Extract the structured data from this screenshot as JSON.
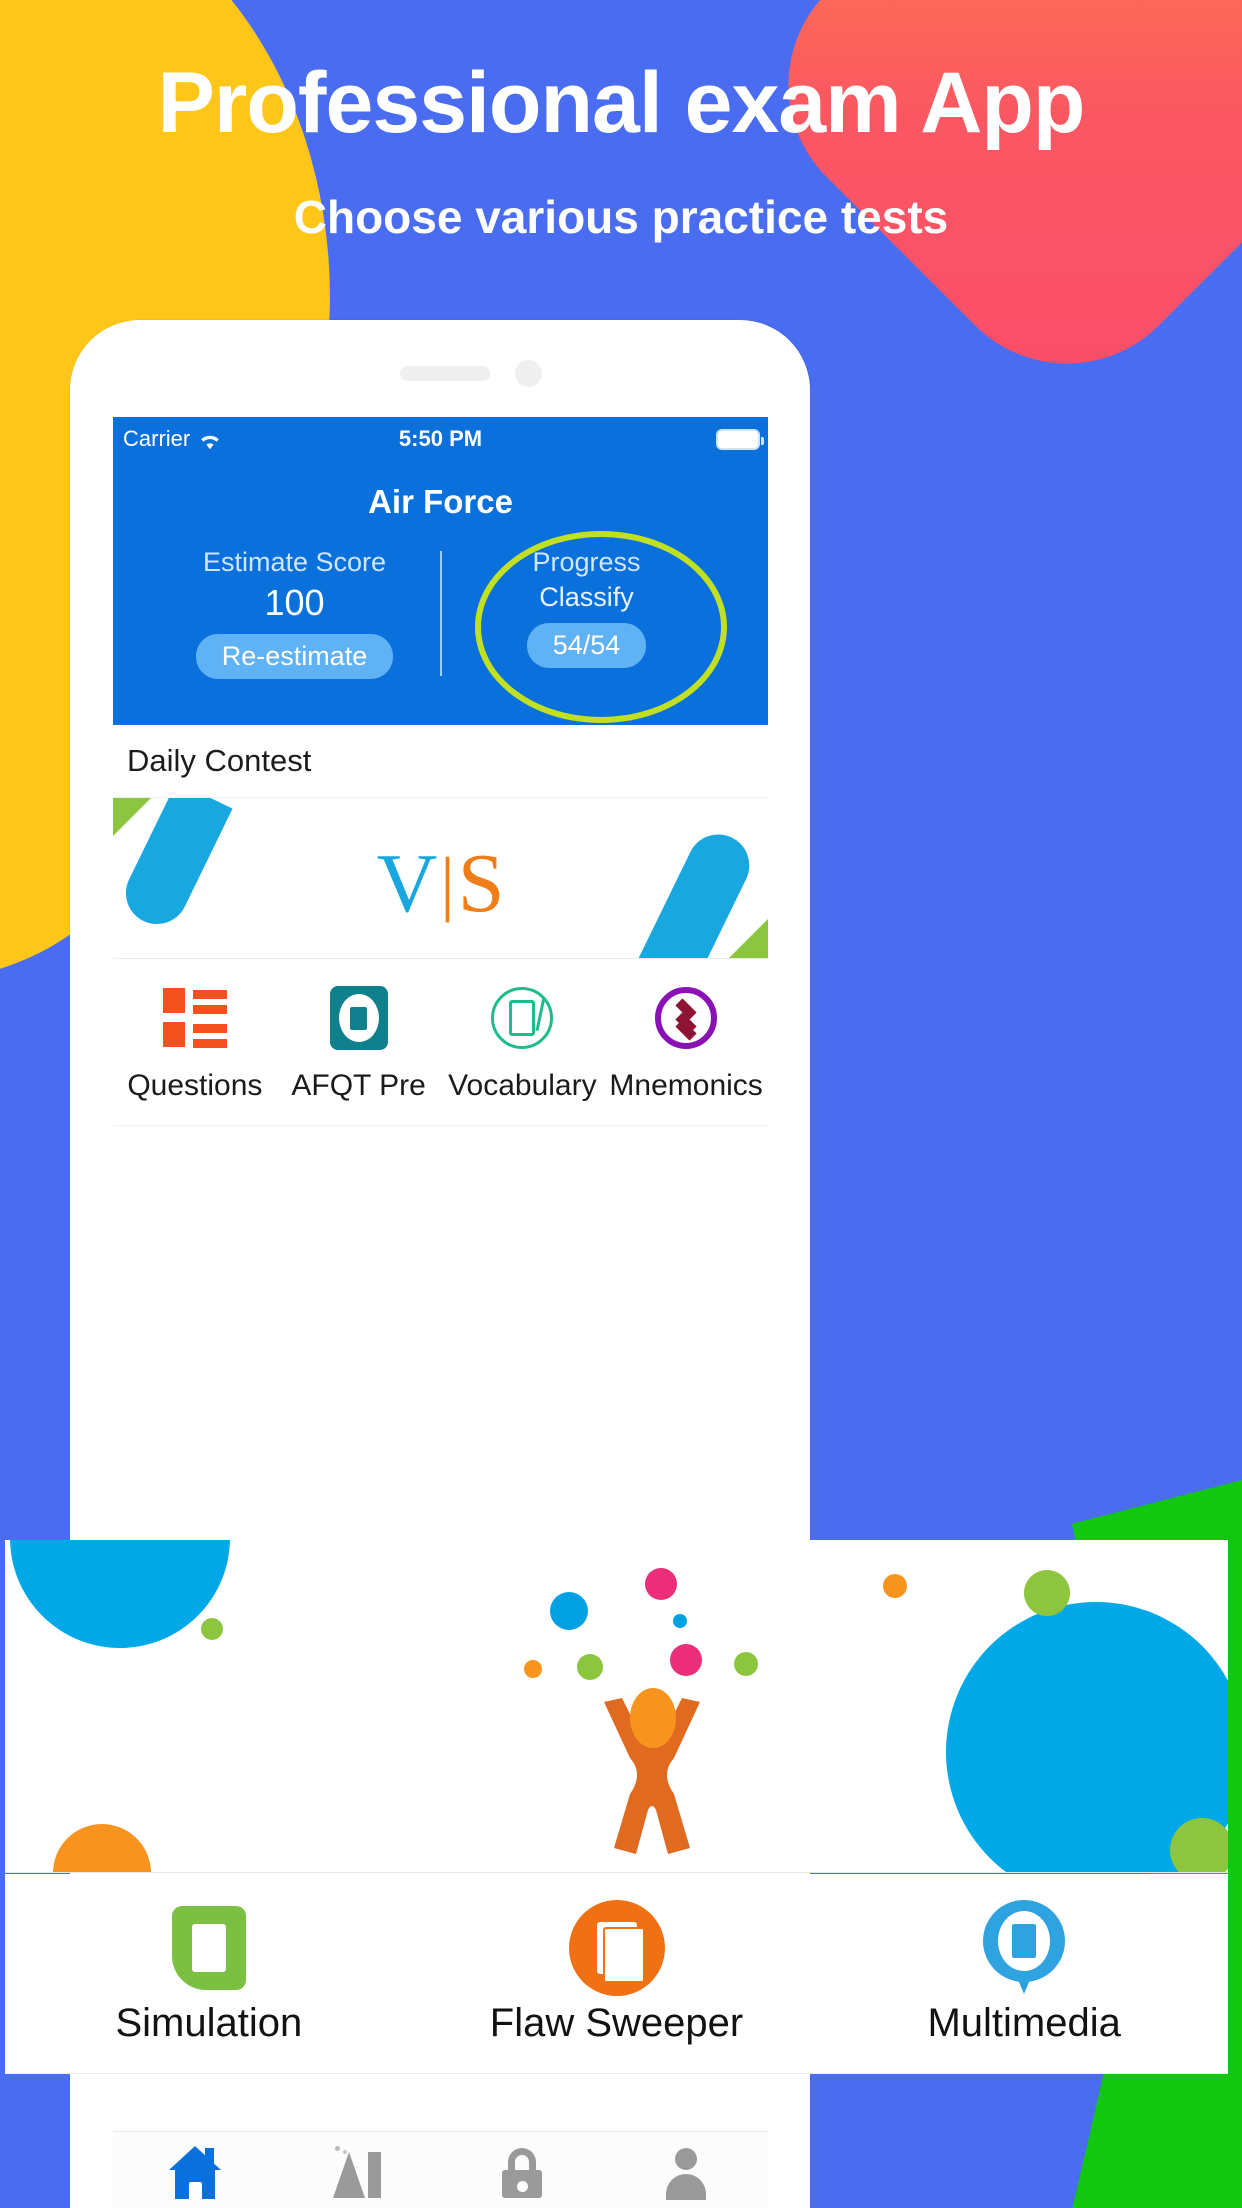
{
  "hero": {
    "title": "Professional exam App",
    "subtitle": "Choose various practice tests"
  },
  "colors": {
    "background_blue": "#4a6cf0",
    "header_blue": "#0a70dc",
    "accent_yellow": "#ffc61a",
    "accent_red": "#fa4c6a",
    "highlight_green": "#c2e022",
    "pill_blue": "#5fb2f4"
  },
  "phone": {
    "status_bar": {
      "carrier": "Carrier",
      "wifi_icon": "wifi-icon",
      "time": "5:50 PM",
      "battery_icon": "battery-icon"
    },
    "app_title": "Air Force",
    "stats": {
      "estimate": {
        "label": "Estimate Score",
        "value": "100",
        "button": "Re-estimate"
      },
      "progress": {
        "label": "Progress",
        "sublabel": "Classify",
        "value": "54/54"
      }
    },
    "contest": {
      "title": "Daily Contest",
      "vs_left": "V",
      "vs_bar": "|",
      "vs_right": "S"
    },
    "features": [
      {
        "label": "Questions",
        "icon": "questions-grid-icon"
      },
      {
        "label": "AFQT Pre",
        "icon": "document-badge-icon"
      },
      {
        "label": "Vocabulary",
        "icon": "scroll-quill-icon"
      },
      {
        "label": "Mnemonics",
        "icon": "diamond-stack-icon"
      }
    ],
    "bottom_features": [
      {
        "label": "Simulation",
        "icon": "green-document-icon"
      },
      {
        "label": "Flaw Sweeper",
        "icon": "orange-pages-icon"
      },
      {
        "label": "Multimedia",
        "icon": "blue-pin-card-icon"
      }
    ],
    "tabs": [
      {
        "name": "home",
        "icon": "home-icon",
        "active": true
      },
      {
        "name": "flask",
        "icon": "flask-icon",
        "active": false
      },
      {
        "name": "lock",
        "icon": "lock-icon",
        "active": false
      },
      {
        "name": "profile",
        "icon": "person-icon",
        "active": false
      }
    ]
  }
}
